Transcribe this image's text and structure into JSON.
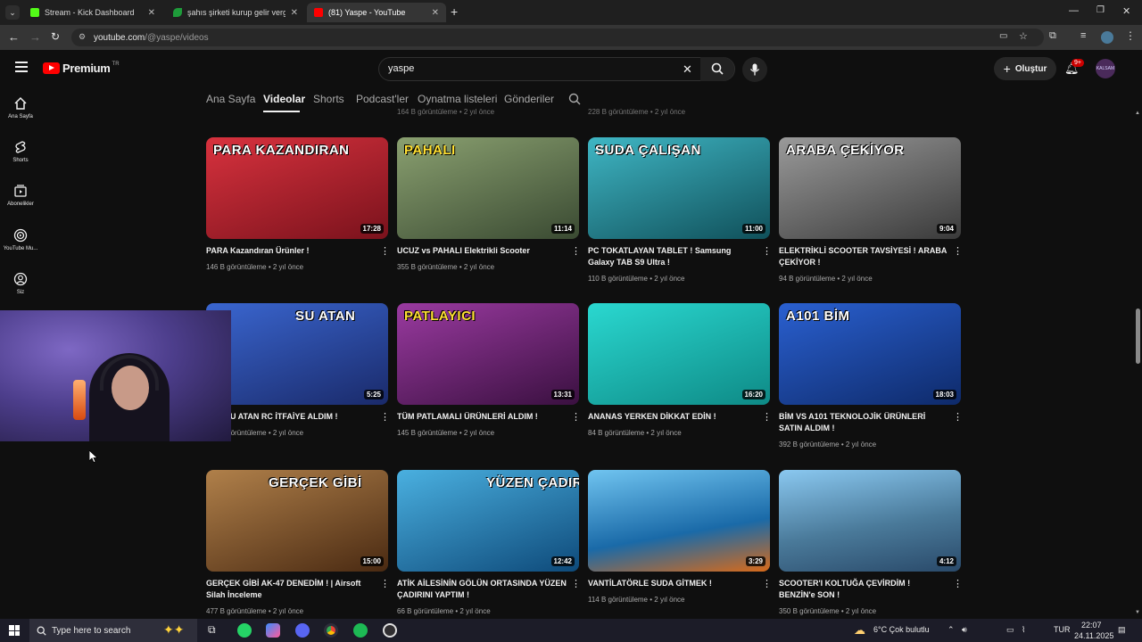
{
  "browser": {
    "tabs": [
      {
        "title": "Stream - Kick Dashboard",
        "favicon_color": "#53fc18",
        "active": false
      },
      {
        "title": "şahıs şirketi kurup gelir vergisin",
        "favicon_color": "#1e9b3a",
        "active": false
      },
      {
        "title": "(81) Yaspe - YouTube",
        "favicon_color": "#ff0000",
        "active": true
      }
    ],
    "new_tab_label": "+",
    "url_host": "youtube.com",
    "url_path": "/@yaspe/videos"
  },
  "youtube": {
    "logo_text": "Premium",
    "logo_sup": "TR",
    "search_value": "yaspe",
    "create_label": "Oluştur",
    "notification_count": "9+",
    "avatar_label": "KALSAM"
  },
  "left_rail": [
    {
      "label": "Ana Sayfa",
      "icon": "home-icon"
    },
    {
      "label": "Shorts",
      "icon": "shorts-icon"
    },
    {
      "label": "Abonelikler",
      "icon": "subscriptions-icon"
    },
    {
      "label": "YouTube Mu...",
      "icon": "youtube-music-icon"
    },
    {
      "label": "Siz",
      "icon": "you-icon"
    }
  ],
  "channel_tabs": [
    "Ana Sayfa",
    "Videolar",
    "Shorts",
    "Podcast'ler",
    "Oynatma listeleri",
    "Gönderiler"
  ],
  "active_channel_tab": "Videolar",
  "previous_row_meta": [
    "164 B görüntüleme • 2 yıl önce",
    "228 B görüntüleme • 2 yıl önce"
  ],
  "videos": [
    {
      "title": "PARA Kazandıran Ürünler !",
      "views": "146 B görüntüleme",
      "age": "2 yıl önce",
      "duration": "17:28",
      "thumb_text": "PARA KAZANDIRAN",
      "thumb_color": "#b0202a"
    },
    {
      "title": "UCUZ vs PAHALI Elektrikli Scooter",
      "views": "355 B görüntüleme",
      "age": "2 yıl önce",
      "duration": "11:14",
      "thumb_text": "PAHALI",
      "thumb_color": "#5d7550"
    },
    {
      "title": "PC TOKATLAYAN TABLET ! Samsung Galaxy TAB S9 Ultra !",
      "views": "110 B görüntüleme",
      "age": "2 yıl önce",
      "duration": "11:00",
      "thumb_text": "SUDA ÇALIŞAN",
      "thumb_color": "#1f8fa0"
    },
    {
      "title": "ELEKTRİKLİ SCOOTER TAVSİYESİ ! ARABA ÇEKİYOR !",
      "views": "94 B görüntüleme",
      "age": "2 yıl önce",
      "duration": "9:04",
      "thumb_text": "ARABA ÇEKİYOR",
      "thumb_color": "#6b6b6b"
    },
    {
      "title": "DEV SU ATAN RC İTFAİYE ALDIM !",
      "views": "200 B görüntüleme",
      "age": "2 yıl önce",
      "duration": "5:25",
      "thumb_text": "SU ATAN",
      "thumb_color": "#2a4fae"
    },
    {
      "title": "TÜM PATLAMALI ÜRÜNLERİ ALDIM !",
      "views": "145 B görüntüleme",
      "age": "2 yıl önce",
      "duration": "13:31",
      "thumb_text": "PATLAYICI",
      "thumb_color": "#7a2a80"
    },
    {
      "title": "ANANAS YERKEN DİKKAT EDİN !",
      "views": "84 B görüntüleme",
      "age": "2 yıl önce",
      "duration": "16:20",
      "thumb_text": "",
      "thumb_color": "#19c7c0"
    },
    {
      "title": "BİM VS A101 TEKNOLOJİK ÜRÜNLERİ SATIN ALDIM !",
      "views": "392 B görüntüleme",
      "age": "2 yıl önce",
      "duration": "18:03",
      "thumb_text": "A101 BİM",
      "thumb_color": "#1c4fb8"
    },
    {
      "title": "GERÇEK GİBİ AK-47 DENEDİM ! | Airsoft Silah İnceleme",
      "views": "477 B görüntüleme",
      "age": "2 yıl önce",
      "duration": "15:00",
      "thumb_text": "GERÇEK GİBİ",
      "thumb_color": "#8a5a2a"
    },
    {
      "title": "ATİK AİLESİNİN GÖLÜN ORTASINDA YÜZEN ÇADIRINI YAPTIM !",
      "views": "66 B görüntüleme",
      "age": "2 yıl önce",
      "duration": "12:42",
      "thumb_text": "YÜZEN ÇADIR",
      "thumb_color": "#1e78b0"
    },
    {
      "title": "VANTİLATÖRLE SUDA GİTMEK !",
      "views": "114 B görüntüleme",
      "age": "2 yıl önce",
      "duration": "3:29",
      "thumb_text": "",
      "thumb_color": "#2a88c8"
    },
    {
      "title": "SCOOTER'I KOLTUĞA ÇEVİRDİM ! BENZİN'e SON !",
      "views": "350 B görüntüleme",
      "age": "2 yıl önce",
      "duration": "4:12",
      "thumb_text": "",
      "thumb_color": "#4a7a9a"
    }
  ],
  "taskbar": {
    "search_placeholder": "Type here to search",
    "weather": "6°C  Çok bulutlu",
    "lang": "TUR",
    "time": "22:07",
    "date": "24.11.2025"
  }
}
